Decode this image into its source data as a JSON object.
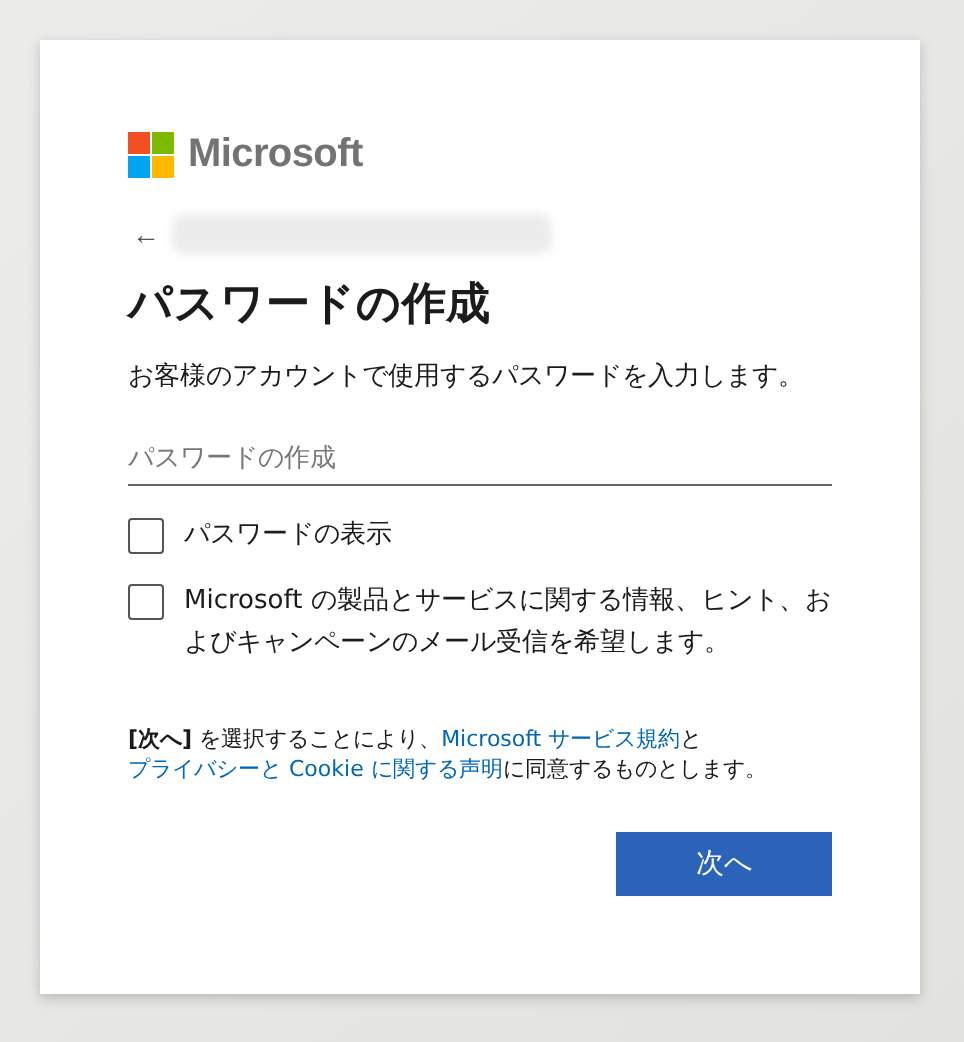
{
  "brand": {
    "name": "Microsoft"
  },
  "back": {
    "symbol": "←"
  },
  "title": "パスワードの作成",
  "description": "お客様のアカウントで使用するパスワードを入力します。",
  "password_field": {
    "placeholder": "パスワードの作成"
  },
  "options": [
    {
      "label": "パスワードの表示",
      "checked": false
    },
    {
      "label": "Microsoft の製品とサービスに関する情報、ヒント、およびキャンペーンのメール受信を希望します。",
      "checked": false
    }
  ],
  "terms": [
    {
      "kind": "text",
      "text": "**[次へ]** を選択することにより、"
    },
    {
      "kind": "link",
      "text": "Microsoft サービス規約"
    },
    {
      "kind": "text",
      "text": "と"
    },
    {
      "kind": "link",
      "text": "プライバシーと Cookie に関する声明"
    },
    {
      "kind": "text",
      "text": "に同意するものとします。"
    }
  ],
  "next_button": "次へ"
}
